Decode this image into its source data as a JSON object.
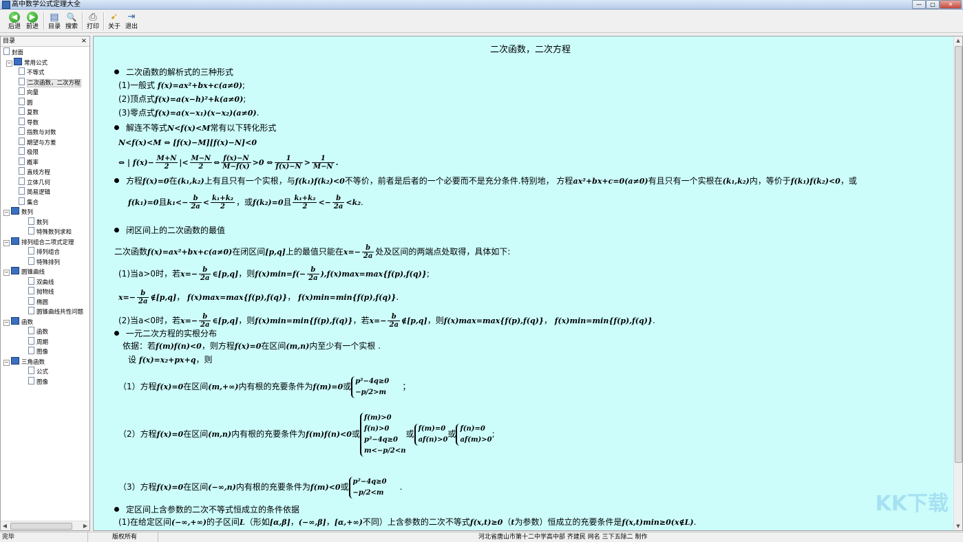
{
  "window": {
    "title": "高中数学公式定理大全",
    "min": "—",
    "max": "□",
    "close": "✕"
  },
  "toolbar": [
    {
      "label": "后退",
      "icon": "back-arrow-icon",
      "glyph": "◀"
    },
    {
      "label": "前进",
      "icon": "forward-arrow-icon",
      "glyph": "▶"
    },
    {
      "label": "目录",
      "icon": "contents-icon",
      "glyph": "▤"
    },
    {
      "label": "搜索",
      "icon": "search-icon",
      "glyph": "🔍"
    },
    {
      "label": "打印",
      "icon": "printer-icon",
      "glyph": "⎙"
    },
    {
      "label": "关于",
      "icon": "about-icon",
      "glyph": "➹"
    },
    {
      "label": "退出",
      "icon": "exit-icon",
      "glyph": "⇥"
    }
  ],
  "sidebar": {
    "header": "目录",
    "close": "×",
    "items": [
      {
        "label": "封面",
        "type": "doc",
        "level": 1
      },
      {
        "label": "常用公式",
        "type": "book",
        "level": 0,
        "expanded": true
      },
      {
        "label": "不等式",
        "type": "doc",
        "level": 2
      },
      {
        "label": "二次函数，二次方程",
        "type": "doc",
        "level": 2,
        "selected": true
      },
      {
        "label": "向量",
        "type": "doc",
        "level": 2
      },
      {
        "label": "圆",
        "type": "doc",
        "level": 2
      },
      {
        "label": "复数",
        "type": "doc",
        "level": 2
      },
      {
        "label": "导数",
        "type": "doc",
        "level": 2
      },
      {
        "label": "指数与对数",
        "type": "doc",
        "level": 2
      },
      {
        "label": "期望与方差",
        "type": "doc",
        "level": 2
      },
      {
        "label": "极限",
        "type": "doc",
        "level": 2
      },
      {
        "label": "概率",
        "type": "doc",
        "level": 2
      },
      {
        "label": "直线方程",
        "type": "doc",
        "level": 2
      },
      {
        "label": "立体几何",
        "type": "doc",
        "level": 2
      },
      {
        "label": "简易逻辑",
        "type": "doc",
        "level": 2
      },
      {
        "label": "集合",
        "type": "doc",
        "level": 2
      },
      {
        "label": "数列",
        "type": "book",
        "level": 1,
        "expanded": true
      },
      {
        "label": "数列",
        "type": "doc",
        "level": 3
      },
      {
        "label": "特殊数列求和",
        "type": "doc",
        "level": 3
      },
      {
        "label": "排列组合二项式定理",
        "type": "book",
        "level": 1,
        "expanded": true
      },
      {
        "label": "排列组合",
        "type": "doc",
        "level": 3
      },
      {
        "label": "特殊排列",
        "type": "doc",
        "level": 3
      },
      {
        "label": "圆锥曲线",
        "type": "book",
        "level": 1,
        "expanded": true
      },
      {
        "label": "双曲线",
        "type": "doc",
        "level": 3
      },
      {
        "label": "抛物线",
        "type": "doc",
        "level": 3
      },
      {
        "label": "椭圆",
        "type": "doc",
        "level": 3
      },
      {
        "label": "圆锥曲线共性问题",
        "type": "doc",
        "level": 3
      },
      {
        "label": "函数",
        "type": "book",
        "level": 1,
        "expanded": true
      },
      {
        "label": "函数",
        "type": "doc",
        "level": 3
      },
      {
        "label": "周期",
        "type": "doc",
        "level": 3
      },
      {
        "label": "图像",
        "type": "doc",
        "level": 3
      },
      {
        "label": "三角函数",
        "type": "book",
        "level": 1,
        "expanded": true
      },
      {
        "label": "公式",
        "type": "doc",
        "level": 3
      },
      {
        "label": "图像",
        "type": "doc",
        "level": 3
      }
    ]
  },
  "doc": {
    "title": "二次函数，二次方程",
    "s1": "二次函数的解析式的三种形式",
    "s1a_label": "(1)一般式",
    "s1a_math": "f(x)=ax²+bx+c(a≠0)",
    "s1b_label": "(2)顶点式",
    "s1b_math": "f(x)=a(x−h)²+k(a≠0)",
    "s1c_label": "(3)零点式",
    "s1c_math": "f(x)=a(x−x₁)(x−x₂)(a≠0)",
    "semi": ";",
    "period": ".",
    "s2_pre": "解连不等式",
    "s2_math": "N<f(x)<M",
    "s2_post": "常有以下转化形式",
    "s2_line1": "N<f(x)<M ⇔ [f(x)−M][f(x)−N]<0",
    "s2_l2_a": "⇔ | f(x)−",
    "s2_l2_f1n": "M+N",
    "s2_l2_f1d": "2",
    "s2_l2_b": "|<",
    "s2_l2_f2n": "M−N",
    "s2_l2_f2d": "2",
    "s2_l2_c": "⇔",
    "s2_l2_f3n": "f(x)−N",
    "s2_l2_f3d": "M−f(x)",
    "s2_l2_d": ">0 ⇔",
    "s2_l2_f4n": "1",
    "s2_l2_f4d": "f(x)−N",
    "s2_l2_e": ">",
    "s2_l2_f5n": "1",
    "s2_l2_f5d": "M−N",
    "s2_l2_f": ".",
    "s3_a": "方程",
    "s3_m1": "f(x)=0",
    "s3_b": "在",
    "s3_m2": "(k₁,k₂)",
    "s3_c": "上有且只有一个实根，与",
    "s3_m3": "f(k₁)f(k₂)<0",
    "s3_d": "不等价，前者是后者的一个必要而不是充分条件.特别地， 方程",
    "s3_m4": "ax²+bx+c=0(a≠0)",
    "s3_e": "有且只有一个实根在",
    "s3_m5": "(k₁,k₂)",
    "s3_f": "内，等价于",
    "s3_m6": "f(k₁)f(k₂)<0",
    "s3_g": "，或",
    "s3_l2_m1": "f(k₁)=0",
    "s3_l2_a": "且",
    "s3_l2_m2": "k₁<−",
    "s3_l2_f1n": "b",
    "s3_l2_f1d": "2a",
    "s3_l2_m3": "<",
    "s3_l2_f2n": "k₁+k₂",
    "s3_l2_f2d": "2",
    "s3_l2_b": "，或",
    "s3_l2_m4": "f(k₂)=0",
    "s3_l2_c": "且",
    "s3_l2_f3n": "k₁+k₂",
    "s3_l2_f3d": "2",
    "s3_l2_m5": "<−",
    "s3_l2_f4n": "b",
    "s3_l2_f4d": "2a",
    "s3_l2_m6": "<k₂",
    "s3_l2_d": ".",
    "s4": "闭区间上的二次函数的最值",
    "s4_l1_a": "二次函数",
    "s4_l1_m1": "f(x)=ax²+bx+c(a≠0)",
    "s4_l1_b": "在闭区间",
    "s4_l1_m2": "[p,q]",
    "s4_l1_c": "上的最值只能在",
    "s4_l1_m3": "x=−",
    "s4_l1_fn": "b",
    "s4_l1_fd": "2a",
    "s4_l1_d": "处及区间的两端点处取得，具体如下:",
    "s4_l2_a": "(1)当a>0时，若",
    "s4_l2_m1": "x=−",
    "s4_l2_fn": "b",
    "s4_l2_fd": "2a",
    "s4_l2_m2": "∈[p,q]",
    "s4_l2_b": "，则",
    "s4_l2_m3": "f(x)min=f(−",
    "s4_l2_f2n": "b",
    "s4_l2_f2d": "2a",
    "s4_l2_m4": "),f(x)max=max{f(p),f(q)}",
    "s4_l2_c": ";",
    "s4_l3_m1": "x=−",
    "s4_l3_fn": "b",
    "s4_l3_fd": "2a",
    "s4_l3_m2": "∉[p,q]",
    "s4_l3_a": "，",
    "s4_l3_m3": "f(x)max=max{f(p),f(q)}",
    "s4_l3_b": "，",
    "s4_l3_m4": "f(x)min=min{f(p),f(q)}",
    "s4_l3_c": ".",
    "s4_l4_a": "(2)当a<0时，若",
    "s4_l4_m1": "x=−",
    "s4_l4_fn": "b",
    "s4_l4_fd": "2a",
    "s4_l4_m2": "∈[p,q]",
    "s4_l4_b": "，则",
    "s4_l4_m3": "f(x)min=min{f(p),f(q)}",
    "s4_l4_c": "，若",
    "s4_l4_m4": "x=−",
    "s4_l4_f2n": "b",
    "s4_l4_f2d": "2a",
    "s4_l4_m5": "∉[p,q]",
    "s4_l4_d": "，则",
    "s4_l4_m6": "f(x)max=max{f(p),f(q)}",
    "s4_l4_e": "，",
    "s4_l4_m7": "f(x)min=min{f(p),f(q)}",
    "s4_l4_f": ".",
    "s5": "一元二次方程的实根分布",
    "s5_l1_a": "依据：若",
    "s5_l1_m1": "f(m)f(n)<0",
    "s5_l1_b": "，则方程",
    "s5_l1_m2": "f(x)=0",
    "s5_l1_c": "在区间",
    "s5_l1_m3": "(m,n)",
    "s5_l1_d": "内至少有一个实根 .",
    "s5_l2_a": "设",
    "s5_l2_m1": "f(x)=x₂+px+q",
    "s5_l2_b": "，则",
    "s5_c1_a": "（1）方程",
    "s5_c1_m1": "f(x)=0",
    "s5_c1_b": "在区间",
    "s5_c1_m2": "(m,+∞)",
    "s5_c1_c": "内有根的充要条件为",
    "s5_c1_m3": "f(m)=0",
    "s5_c1_d": "或",
    "s5_c1_br1": "p²−4q≥0",
    "s5_c1_br2": "−p/2>m",
    "s5_c1_e": "；",
    "s5_c2_a": "（2）方程",
    "s5_c2_m1": "f(x)=0",
    "s5_c2_b": "在区间",
    "s5_c2_m2": "(m,n)",
    "s5_c2_c": "内有根的充要条件为",
    "s5_c2_m3": "f(m)f(n)<0",
    "s5_c2_d": "或",
    "s5_c2_br1": "f(m)>0",
    "s5_c2_br2": "f(n)>0",
    "s5_c2_br3": "p²−4q≥0",
    "s5_c2_br4": "m<−p/2<n",
    "s5_c2_e": "或",
    "s5_c2_bb1": "f(m)=0",
    "s5_c2_bb2": "af(n)>0",
    "s5_c2_f": "或",
    "s5_c2_bc1": "f(n)=0",
    "s5_c2_bc2": "af(m)>0",
    "s5_c2_g": ";",
    "s5_c3_a": "（3）方程",
    "s5_c3_m1": "f(x)=0",
    "s5_c3_b": "在区间",
    "s5_c3_m2": "(−∞,n)",
    "s5_c3_c": "内有根的充要条件为",
    "s5_c3_m3": "f(m)<0",
    "s5_c3_d": "或",
    "s5_c3_br1": "p²−4q≥0",
    "s5_c3_br2": "−p/2<m",
    "s5_c3_e": ".",
    "s6": "定区间上含参数的二次不等式恒成立的条件依据",
    "s6_l1_a": "(1)在给定区间",
    "s6_l1_m1": "(−∞,+∞)",
    "s6_l1_b": "的子区间",
    "s6_l1_m2": "L",
    "s6_l1_c": "（形如",
    "s6_l1_m3": "[α,β]",
    "s6_l1_d": "，",
    "s6_l1_m4": "(−∞,β]",
    "s6_l1_e": "，",
    "s6_l1_m5": "[α,+∞)",
    "s6_l1_f": "不同）上含参数的二次不等式",
    "s6_l1_m6": "f(x,t)≥0",
    "s6_l1_g": "（",
    "s6_l1_m7": "t",
    "s6_l1_h": "为参数）恒成立的充要条件是",
    "s6_l1_m8": "f(x,t)min≥0(x∉L)",
    "s6_l1_i": "."
  },
  "status": {
    "ready": "完毕",
    "copyright": "版权所有",
    "author": "河北省唐山市第十二中学高中部   齐建民  网名 三下五除二  制作"
  },
  "watermark": "KK下载"
}
